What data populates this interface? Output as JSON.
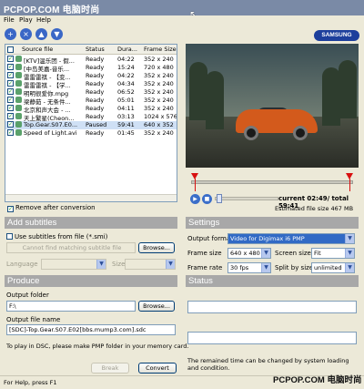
{
  "window": {
    "title": "PCPOP.COM 电脑时尚"
  },
  "menu": [
    "File",
    "Play",
    "Help"
  ],
  "toolbar": {
    "brand": "SAMSUNG"
  },
  "file_list": {
    "columns": [
      "Source file",
      "Status",
      "Dura...",
      "Frame Size"
    ],
    "rows": [
      {
        "name": "[KTV]温乐团 - 假...",
        "status": "Ready",
        "duration": "04:22",
        "frame": "352 x 240",
        "selected": false
      },
      {
        "name": "[中岛美嘉-音乐...",
        "status": "Ready",
        "duration": "15:24",
        "frame": "720 x 480",
        "selected": false
      },
      {
        "name": "雷雷雷祺 - 【变...",
        "status": "Ready",
        "duration": "04:22",
        "frame": "352 x 240",
        "selected": false
      },
      {
        "name": "雷雷雷祺 - 【学...",
        "status": "Ready",
        "duration": "04:34",
        "frame": "352 x 240",
        "selected": false
      },
      {
        "name": "明明很爱你.mpg",
        "status": "Ready",
        "duration": "06:52",
        "frame": "352 x 240",
        "selected": false
      },
      {
        "name": "梁静茹 - 无条件...",
        "status": "Ready",
        "duration": "05:01",
        "frame": "352 x 240",
        "selected": false
      },
      {
        "name": "北京和声大会 - ...",
        "status": "Ready",
        "duration": "04:11",
        "frame": "352 x 240",
        "selected": false
      },
      {
        "name": "天上繁星(Cheon...",
        "status": "Ready",
        "duration": "03:13",
        "frame": "1024 x 576",
        "selected": false
      },
      {
        "name": "Top.Gear.S07.E0...",
        "status": "Paused",
        "duration": "59:41",
        "frame": "640 x 352",
        "selected": true
      },
      {
        "name": "Speed of Light.avi",
        "status": "Ready",
        "duration": "01:45",
        "frame": "352 x 240",
        "selected": false
      }
    ]
  },
  "remove_after_conversion": "Remove after conversion",
  "player": {
    "current_label": "current",
    "current": "02:49",
    "total_label": "total",
    "total": "59:41",
    "estimated_size": "Estimated file size 467 MB",
    "progress_fraction": 0.05
  },
  "subtitles": {
    "header": "Add subtitles",
    "use_from_file": "Use subtitles from file (*.smi)",
    "placeholder_file": "Cannot find matching subtitle file",
    "browse": "Browse...",
    "language_label": "Language",
    "size_label": "Size"
  },
  "produce": {
    "header": "Produce",
    "output_folder_label": "Output folder",
    "output_folder": "F:\\",
    "browse": "Browse...",
    "output_name_label": "Output file name",
    "output_name": "[SDC]-Top.Gear.S07.E02[bbs.mump3.com].sdc",
    "note": "To play in DSC, please make PMP folder in your memory card.",
    "break_btn": "Break",
    "convert_btn": "Convert"
  },
  "settings": {
    "header": "Settings",
    "output_format_label": "Output format",
    "output_format": "Video for Digimax i6 PMP",
    "frame_size_label": "Frame size",
    "frame_size": "640 x 480",
    "screen_size_label": "Screen size",
    "screen_size": "Fit",
    "frame_rate_label": "Frame rate",
    "frame_rate": "30 fps",
    "split_label": "Split by size",
    "split": "unlimited"
  },
  "status": {
    "header": "Status",
    "remaining_note": "The remained time can be changed by system loading and condition."
  },
  "statusbar": {
    "text": "For Help, press F1"
  },
  "watermark": "PCPOP.COM 电脑时尚",
  "colors": {
    "section_header": "#a8a8a8",
    "selection": "#316ac5",
    "marker": "#d81010"
  }
}
